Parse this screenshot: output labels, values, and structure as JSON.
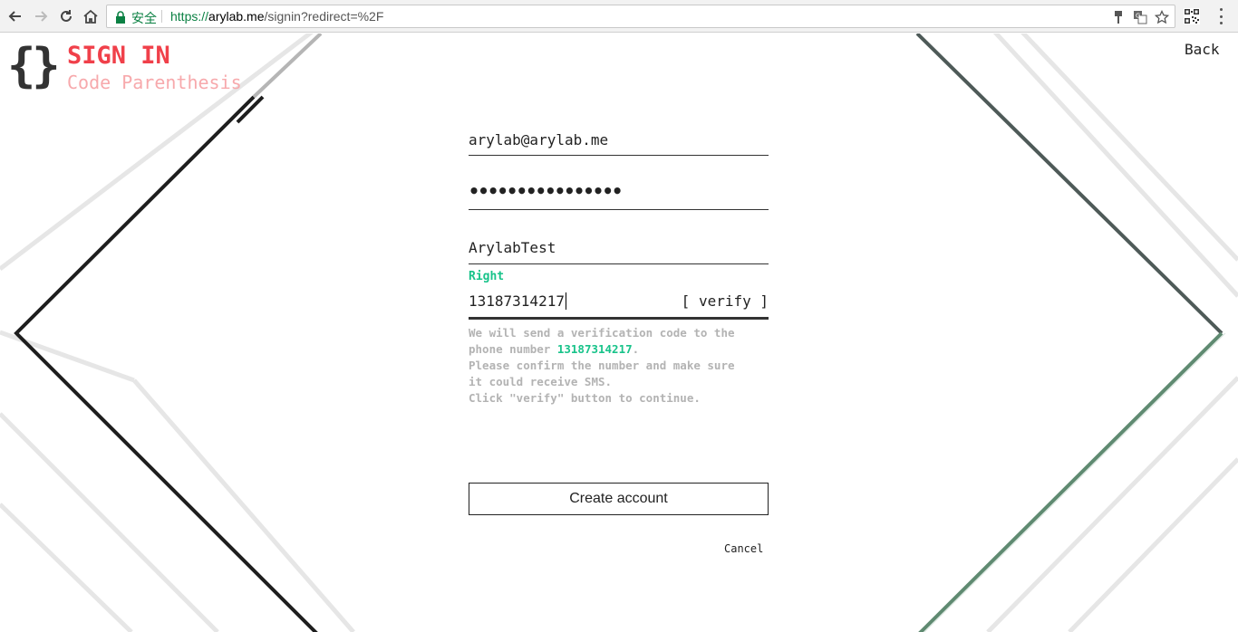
{
  "browser": {
    "secure_label": "安全",
    "url_scheme": "https://",
    "url_host": "arylab.me",
    "url_path": "/signin?redirect=%2F",
    "icons": [
      "back-arrow-icon",
      "forward-arrow-icon",
      "reload-icon",
      "home-icon",
      "lock-icon",
      "pin-icon",
      "translate-icon",
      "star-icon",
      "qr-code-icon",
      "menu-dots-icon"
    ]
  },
  "brand": {
    "braces": "{}",
    "title": "SIGN IN",
    "subtitle": "Code Parenthesis",
    "title_color": "#f0404a",
    "subtitle_color": "#f7a9ac"
  },
  "nav": {
    "back_label": "Back"
  },
  "form": {
    "email_value": "arylab@arylab.me",
    "password_value": "••••••••••••••••",
    "nickname_value": "ArylabTest",
    "status_text": "Right",
    "status_color": "#18c38a",
    "phone_value": "13187314217",
    "verify_label": "[ verify ]",
    "hint": {
      "line1": "We will send a verification code to the",
      "line2_prefix": "phone number ",
      "line2_phone": "13187314217",
      "line2_suffix": ".",
      "line3": "Please confirm the number and make sure",
      "line4": "it could receive SMS.",
      "line5": "Click \"verify\" button to continue."
    },
    "create_label": "Create account",
    "cancel_label": "Cancel"
  }
}
